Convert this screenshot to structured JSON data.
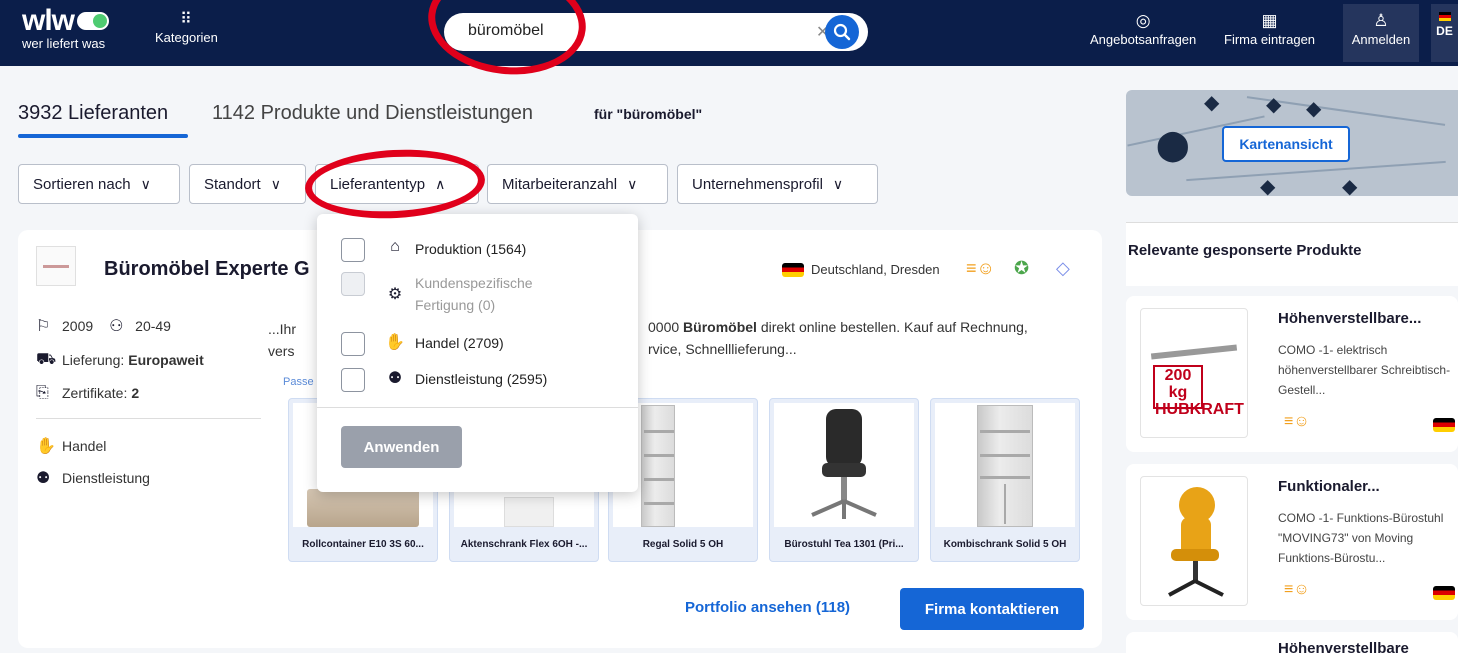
{
  "header": {
    "logo_word": "wlw",
    "logo_sub": "wer liefert was",
    "categories_label": "Kategorien",
    "search_value": "büromöbel",
    "nav": [
      {
        "label": "Angebotsanfragen",
        "icon": "target-icon"
      },
      {
        "label": "Firma eintragen",
        "icon": "building-icon"
      },
      {
        "label": "Anmelden",
        "icon": "user-icon"
      }
    ],
    "language": "DE"
  },
  "tabs": {
    "suppliers": "3932 Lieferanten",
    "products": "1142 Produkte und Dienstleistungen",
    "query": "für \"büromöbel\""
  },
  "filters": [
    {
      "label": "Sortieren nach"
    },
    {
      "label": "Standort"
    },
    {
      "label": "Lieferantentyp"
    },
    {
      "label": "Mitarbeiteranzahl"
    },
    {
      "label": "Unternehmensprofil"
    }
  ],
  "dropdown": {
    "options": [
      {
        "label": "Produktion (1564)",
        "icon": "factory-icon",
        "disabled": false
      },
      {
        "label": "Kundenspezifische Fertigung (0)",
        "icon": "custom-manufacturing-icon",
        "disabled": true
      },
      {
        "label": "Handel (2709)",
        "icon": "handshake-icon",
        "disabled": false
      },
      {
        "label": "Dienstleistung (2595)",
        "icon": "people-icon",
        "disabled": false
      }
    ],
    "apply_label": "Anwenden"
  },
  "card": {
    "name": "Büromöbel Experte G",
    "location": "Deutschland, Dresden",
    "founded": "2009",
    "employees": "20-49",
    "delivery_label": "Lieferung:",
    "delivery_value": "Europaweit",
    "certificates_label": "Zertifikate:",
    "certificates_value": "2",
    "types": [
      "Handel",
      "Dienstleistung"
    ],
    "desc_line1_left": "...Ihr",
    "desc_line1_right_prefix": "0000",
    "desc_line1_right_bold": "Büromöbel",
    "desc_line1_right_suffix": "direkt online bestellen. Kauf auf Rechnung,",
    "desc_line2_left": "vers",
    "desc_line2_right": "rvice, Schnelllieferung...",
    "passend": "Passe",
    "products": [
      {
        "name": "Rollcontainer E10 3S 60..."
      },
      {
        "name": "Aktenschrank Flex 6OH -..."
      },
      {
        "name": "Regal Solid 5 OH"
      },
      {
        "name": "Bürostuhl Tea 1301 (Pri..."
      },
      {
        "name": "Kombischrank Solid 5 OH"
      }
    ],
    "portfolio_label": "Portfolio ansehen (118)",
    "contact_label": "Firma kontaktieren"
  },
  "sidebar": {
    "map_button": "Kartenansicht",
    "sponsored_title": "Relevante gesponserte Produkte",
    "sponsored": [
      {
        "title": "Höhenverstellbare...",
        "desc": "COMO -1- elektrisch höhenverstellbarer Schreibtisch-Gestell...",
        "image_text": "200 kg HUBKRAFT"
      },
      {
        "title": "Funktionaler...",
        "desc": "COMO -1- Funktions-Bürostuhl \"MOVING73\" von Moving Funktions-Bürostu..."
      },
      {
        "title": "Höhenverstellbare"
      }
    ]
  },
  "colors": {
    "header_bg": "#0b1e4a",
    "primary": "#1566d6",
    "annotation": "#e0001b"
  }
}
